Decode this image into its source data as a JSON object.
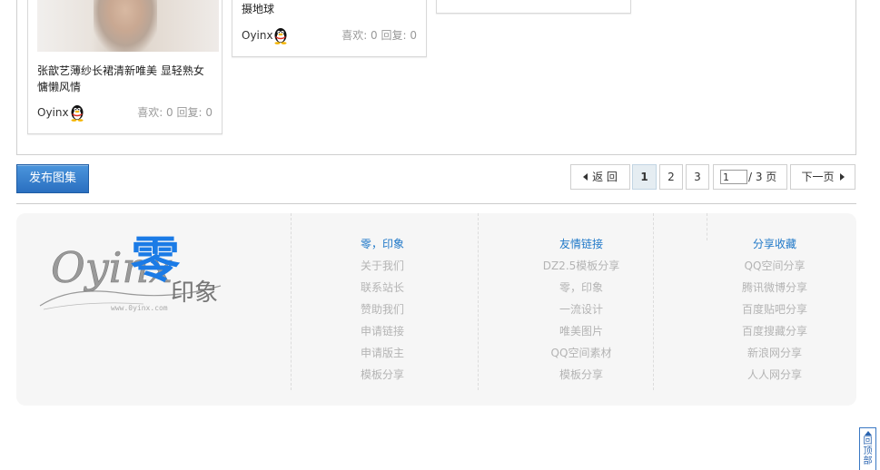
{
  "cards": [
    {
      "title": "张歆艺薄纱长裙清新唯美 显轻熟女慵懒风情",
      "author": "Oyinx",
      "stats": "喜欢: 0 回复: 0"
    },
    {
      "title": "摄地球",
      "author": "Oyinx",
      "stats": "喜欢: 0 回复: 0"
    }
  ],
  "toolbar": {
    "publish_label": "发布图集"
  },
  "pager": {
    "back_label": "返 回",
    "pages": [
      "1",
      "2",
      "3"
    ],
    "current_page_value": "1",
    "total_label": "/ 3 页",
    "next_label": "下一页"
  },
  "footer": {
    "logo": {
      "script_text": "Oyinx",
      "accent_char": "零",
      "tail_text": "印象",
      "url_text": "www.0yinx.com"
    },
    "columns": [
      {
        "title": "零，印象",
        "items": [
          "关于我们",
          "联系站长",
          "赞助我们",
          "申请链接",
          "申请版主",
          "模板分享"
        ]
      },
      {
        "title": "友情链接",
        "items": [
          "DZ2.5模板分享",
          "零，印象",
          "一流设计",
          "唯美图片",
          "QQ空间素材",
          "模板分享"
        ]
      },
      {
        "title": "分享收藏",
        "items": [
          "QQ空间分享",
          "腾讯微博分享",
          "百度贴吧分享",
          "百度搜藏分享",
          "新浪网分享",
          "人人网分享"
        ]
      }
    ]
  },
  "back_to_top": "回顶部",
  "colors": {
    "link_blue": "#1f78c8",
    "button_blue": "#2a6fc0",
    "muted_gray": "#b4b4b4"
  }
}
